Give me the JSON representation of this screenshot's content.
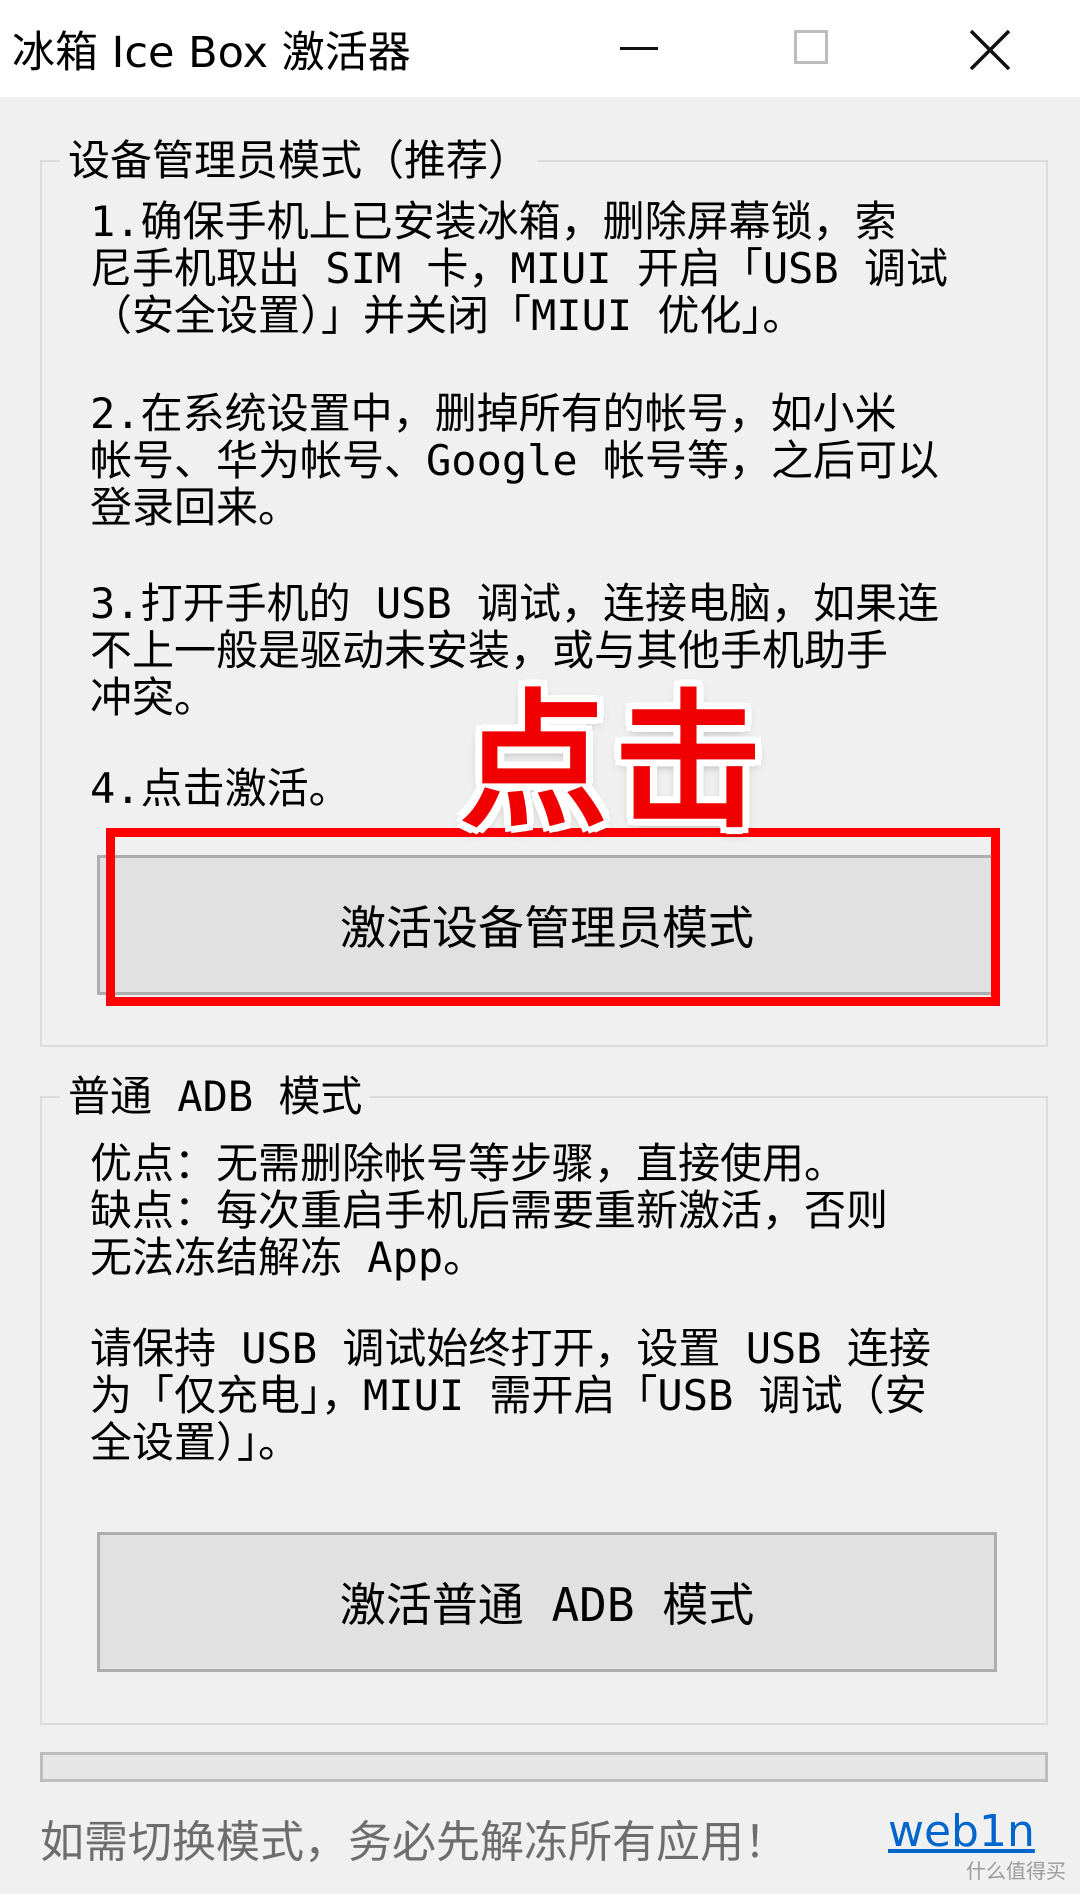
{
  "window": {
    "title": "冰箱 Ice Box 激活器",
    "controls": [
      "minimize-icon",
      "maximize-icon",
      "close-icon"
    ]
  },
  "device_admin": {
    "legend": "设备管理员模式（推荐）",
    "step1": "1.确保手机上已安装冰箱，删除屏幕锁，索\n尼手机取出 SIM 卡，MIUI 开启「USB 调试\n（安全设置）」并关闭「MIUI 优化」。",
    "step2": "2.在系统设置中，删掉所有的帐号，如小米\n帐号、华为帐号、Google 帐号等，之后可以\n登录回来。",
    "step3": "3.打开手机的 USB 调试，连接电脑，如果连\n不上一般是驱动未安装，或与其他手机助手\n冲突。",
    "step4": "4.点击激活。",
    "button_label": "激活设备管理员模式"
  },
  "annotation": {
    "text": "点击",
    "color": "#ff0000"
  },
  "adb": {
    "legend": "普通 ADB 模式",
    "pros_cons": "优点：无需删除帐号等步骤，直接使用。\n缺点：每次重启手机后需要重新激活，否则\n无法冻结解冻 App。",
    "note": "请保持 USB 调试始终打开，设置 USB 连接\n为「仅充电」，MIUI 需开启「USB 调试（安\n全设置）」。",
    "button_label": "激活普通 ADB 模式"
  },
  "progress": {
    "value": 0
  },
  "status": {
    "text": "如需切换模式，务必先解冻所有应用！",
    "link": "web1n"
  },
  "watermark": "什么值得买"
}
